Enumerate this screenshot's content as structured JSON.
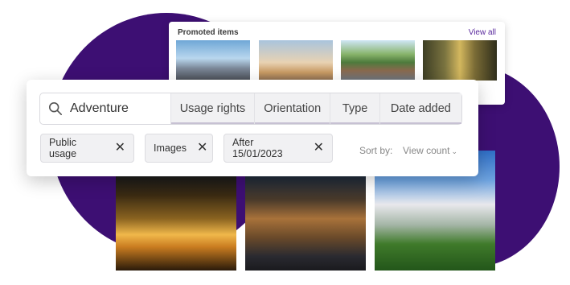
{
  "promoted": {
    "title": "Promoted items",
    "view_all": "View all"
  },
  "search": {
    "query": "Adventure",
    "tabs": [
      {
        "label": "Usage rights"
      },
      {
        "label": "Orientation"
      },
      {
        "label": "Type"
      },
      {
        "label": "Date added"
      }
    ]
  },
  "filters": [
    {
      "label": "Public usage"
    },
    {
      "label": "Images"
    },
    {
      "label": "After 15/01/2023"
    }
  ],
  "sort": {
    "label": "Sort by:",
    "value": "View count"
  },
  "colors": {
    "accent": "#3d0f73",
    "link": "#5a2a9e"
  }
}
